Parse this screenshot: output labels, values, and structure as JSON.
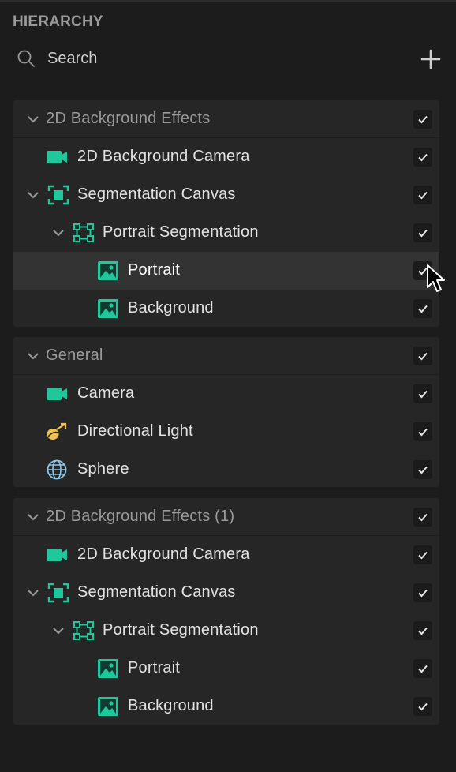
{
  "panel": {
    "title": "HIERARCHY",
    "search_placeholder": "Search"
  },
  "colors": {
    "accent": "#1fc79a",
    "light_yellow": "#f2c14e",
    "sphere_blue": "#8fc7ea",
    "panel_bg": "#262626",
    "selected_bg": "#333333"
  },
  "groups": [
    {
      "label": "2D Background Effects",
      "checked": true,
      "children": [
        {
          "label": "2D Background Camera",
          "icon": "camera-icon",
          "checked": true
        },
        {
          "label": "Segmentation Canvas",
          "icon": "canvas-icon",
          "checked": true
        },
        {
          "label": "Portrait Segmentation",
          "icon": "segmentation-icon",
          "checked": true
        },
        {
          "label": "Portrait",
          "icon": "image-icon",
          "checked": true,
          "selected": true
        },
        {
          "label": "Background",
          "icon": "image-icon",
          "checked": true
        }
      ]
    },
    {
      "label": "General",
      "checked": true,
      "children": [
        {
          "label": "Camera",
          "icon": "camera-icon",
          "checked": true
        },
        {
          "label": "Directional Light",
          "icon": "directional-light-icon",
          "checked": true
        },
        {
          "label": "Sphere",
          "icon": "sphere-icon",
          "checked": true
        }
      ]
    },
    {
      "label": "2D Background Effects (1)",
      "checked": true,
      "children": [
        {
          "label": "2D Background Camera",
          "icon": "camera-icon",
          "checked": true
        },
        {
          "label": "Segmentation Canvas",
          "icon": "canvas-icon",
          "checked": true
        },
        {
          "label": "Portrait Segmentation",
          "icon": "segmentation-icon",
          "checked": true
        },
        {
          "label": "Portrait",
          "icon": "image-icon",
          "checked": true
        },
        {
          "label": "Background",
          "icon": "image-icon",
          "checked": true
        }
      ]
    }
  ]
}
